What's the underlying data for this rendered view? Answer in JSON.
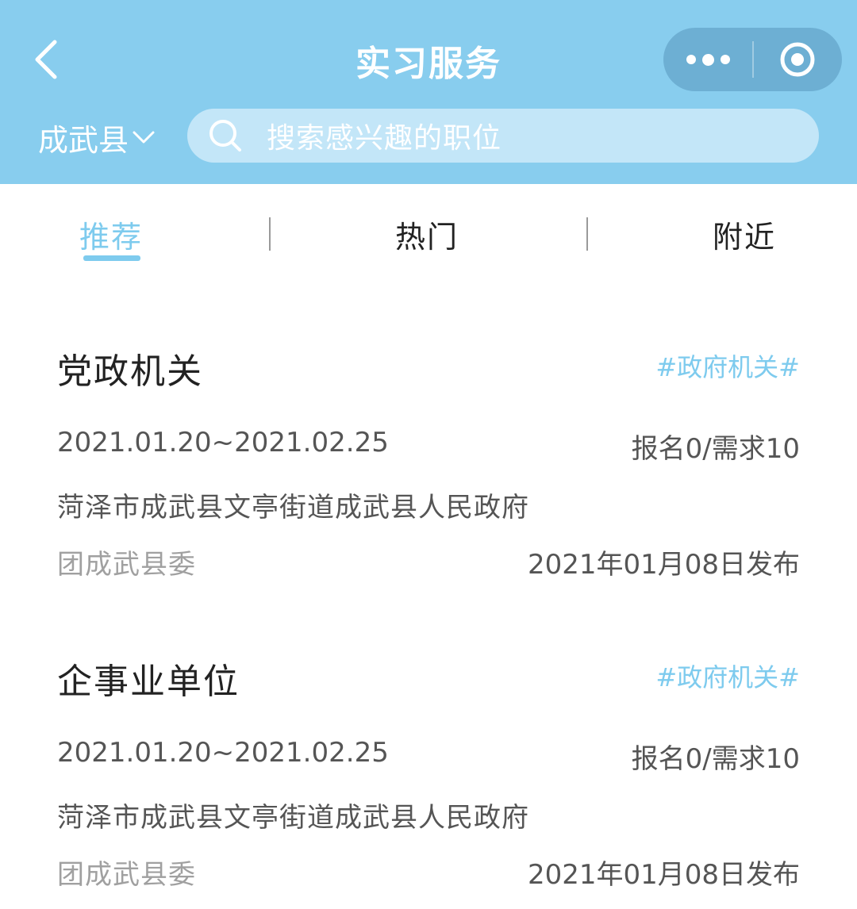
{
  "header": {
    "title": "实习服务",
    "region": "成武县",
    "search_placeholder": "搜索感兴趣的职位"
  },
  "tabs": [
    {
      "label": "推荐",
      "active": true
    },
    {
      "label": "热门",
      "active": false
    },
    {
      "label": "附近",
      "active": false
    }
  ],
  "colors": {
    "header_bg": "#88cdee",
    "accent": "#7ecbee"
  },
  "jobs": [
    {
      "name": "党政机关",
      "tag": "#政府机关#",
      "dates": "2021.01.20~2021.02.25",
      "quota": "报名0/需求10",
      "address": "菏泽市成武县文亭街道成武县人民政府",
      "org": "团成武县委",
      "published": "2021年01月08日发布"
    },
    {
      "name": "企事业单位",
      "tag": "#政府机关#",
      "dates": "2021.01.20~2021.02.25",
      "quota": "报名0/需求10",
      "address": "菏泽市成武县文亭街道成武县人民政府",
      "org": "团成武县委",
      "published": "2021年01月08日发布"
    }
  ]
}
